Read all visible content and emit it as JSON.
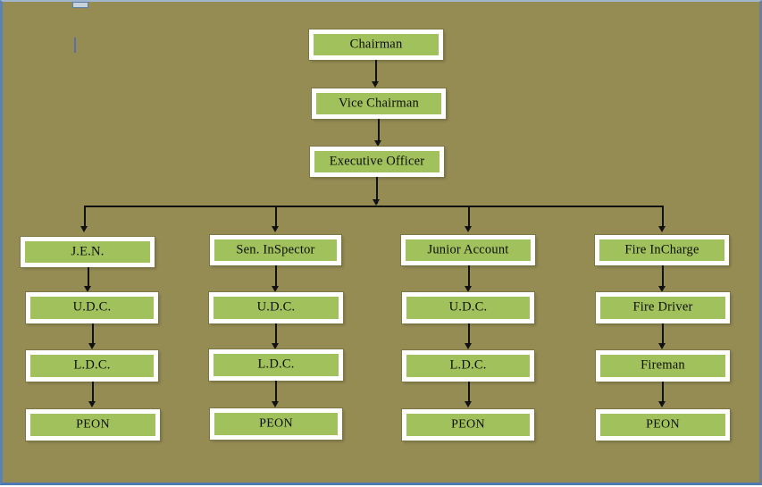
{
  "page": {
    "background_color": "#958c54",
    "border_color": "#5b82b0"
  },
  "chart": {
    "type": "org-chart",
    "node_fill_color": "#a0c15c",
    "node_border_color": "#ffffff",
    "connector_color": "#111111",
    "levels": [
      {
        "name": "level-1",
        "nodes": [
          {
            "id": "chairman",
            "label": "Chairman"
          }
        ]
      },
      {
        "name": "level-2",
        "nodes": [
          {
            "id": "vice-chairman",
            "label": "Vice Chairman"
          }
        ]
      },
      {
        "name": "level-3",
        "nodes": [
          {
            "id": "executive-officer",
            "label": "Executive Officer"
          }
        ]
      },
      {
        "name": "level-4",
        "nodes": [
          {
            "id": "jen",
            "label": "J.E.N."
          },
          {
            "id": "sen-inspector",
            "label": "Sen. InSpector"
          },
          {
            "id": "junior-account",
            "label": "Junior Account"
          },
          {
            "id": "fire-incharge",
            "label": "Fire InCharge"
          }
        ]
      },
      {
        "name": "level-5",
        "nodes": [
          {
            "id": "udc-1",
            "label": "U.D.C."
          },
          {
            "id": "udc-2",
            "label": "U.D.C."
          },
          {
            "id": "udc-3",
            "label": "U.D.C."
          },
          {
            "id": "fire-driver",
            "label": "Fire Driver"
          }
        ]
      },
      {
        "name": "level-6",
        "nodes": [
          {
            "id": "ldc-1",
            "label": "L.D.C."
          },
          {
            "id": "ldc-2",
            "label": "L.D.C."
          },
          {
            "id": "ldc-3",
            "label": "L.D.C."
          },
          {
            "id": "fireman",
            "label": "Fireman"
          }
        ]
      },
      {
        "name": "level-7",
        "nodes": [
          {
            "id": "peon-1",
            "label": "PEON"
          },
          {
            "id": "peon-2",
            "label": "PEON"
          },
          {
            "id": "peon-3",
            "label": "PEON"
          },
          {
            "id": "peon-4",
            "label": "PEON"
          }
        ]
      }
    ]
  }
}
